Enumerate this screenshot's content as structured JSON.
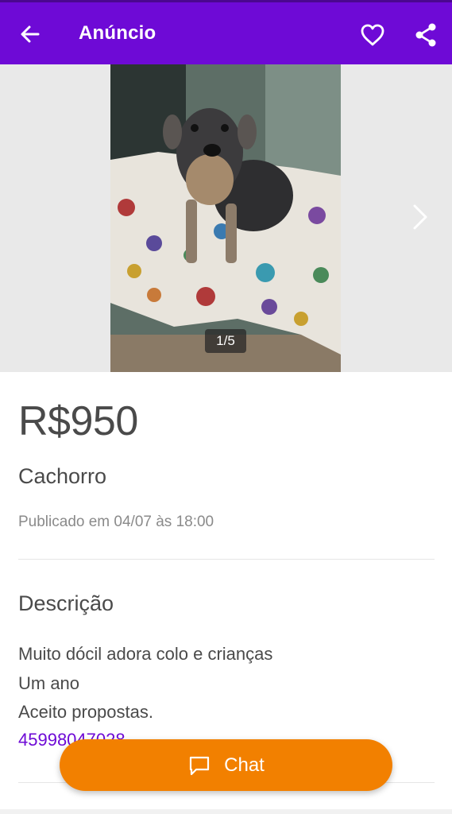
{
  "header": {
    "title": "Anúncio",
    "back_icon": "arrow-left-icon",
    "favorite_icon": "heart-outline-icon",
    "share_icon": "share-icon",
    "background": "#6e0ad6"
  },
  "gallery": {
    "counter": "1/5",
    "next_icon": "chevron-right-icon",
    "current_index": 1,
    "total": 5
  },
  "ad": {
    "price": "R$950",
    "title": "Cachorro",
    "published": "Publicado em 04/07 às 18:00"
  },
  "description": {
    "heading": "Descrição",
    "lines": [
      "Muito dócil adora colo e crianças",
      "Um ano",
      "Aceito propostas."
    ],
    "phone": "45998047028"
  },
  "chat_button": {
    "label": "Chat",
    "icon": "chat-bubble-icon",
    "color": "#f28000"
  }
}
